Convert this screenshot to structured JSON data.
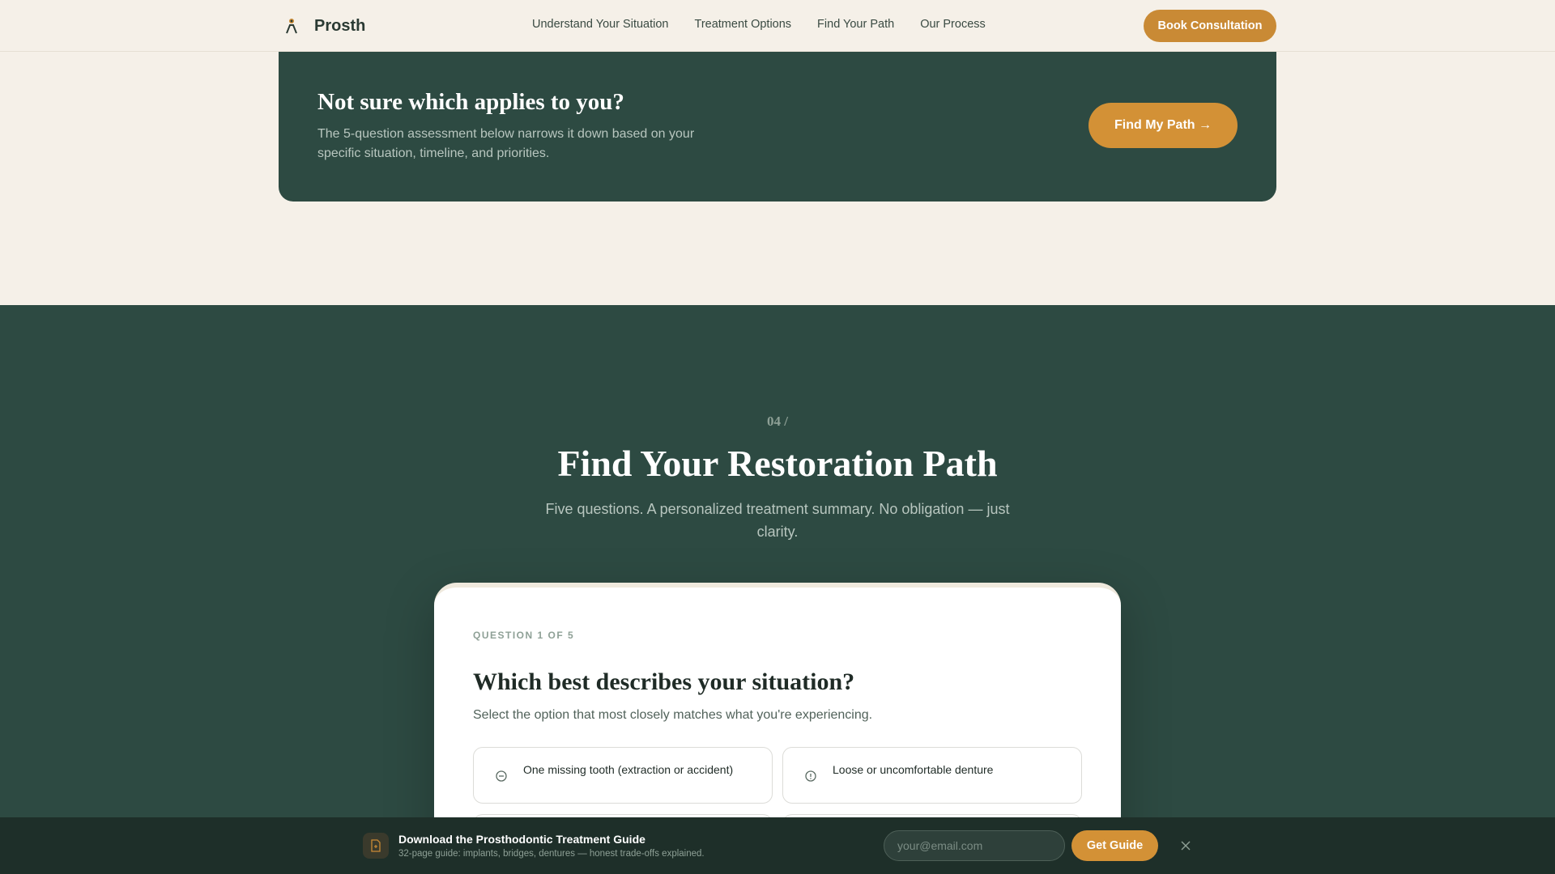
{
  "nav": {
    "brand": "Prosth",
    "brand_icon": "person-tooth-icon",
    "links": [
      "Understand Your Situation",
      "Treatment Options",
      "Find Your Path",
      "Our Process"
    ],
    "cta": "Book Consultation"
  },
  "banner": {
    "title": "Not sure which applies to you?",
    "text": "The 5-question assessment below narrows it down based on your specific situation, timeline, and priorities.",
    "button": "Find My Path →"
  },
  "section": {
    "eyebrow": "04 /",
    "title": "Find Your Restoration Path",
    "subtitle": "Five questions. A personalized treatment summary. No obligation — just clarity."
  },
  "quiz": {
    "progress_label": "QUESTION 1 OF 5",
    "question": "Which best describes your situation?",
    "helper": "Select the option that most closely matches what you're experiencing.",
    "options": [
      {
        "label": "One missing tooth (extraction or accident)",
        "icon": "minus-circle-icon"
      },
      {
        "label": "Loose or uncomfortable denture",
        "icon": "alert-circle-icon"
      },
      {
        "label": "",
        "icon": ""
      },
      {
        "label": "",
        "icon": ""
      }
    ]
  },
  "guide_bar": {
    "title": "Download the Prosthodontic Treatment Guide",
    "subtitle": "32-page guide: implants, bridges, dentures — honest trade-offs explained.",
    "email_placeholder": "your@email.com",
    "button": "Get Guide",
    "icon": "document-icon"
  },
  "colors": {
    "accent": "#d39136",
    "dark_green": "#2d4a42",
    "cream": "#f5f0e8"
  }
}
